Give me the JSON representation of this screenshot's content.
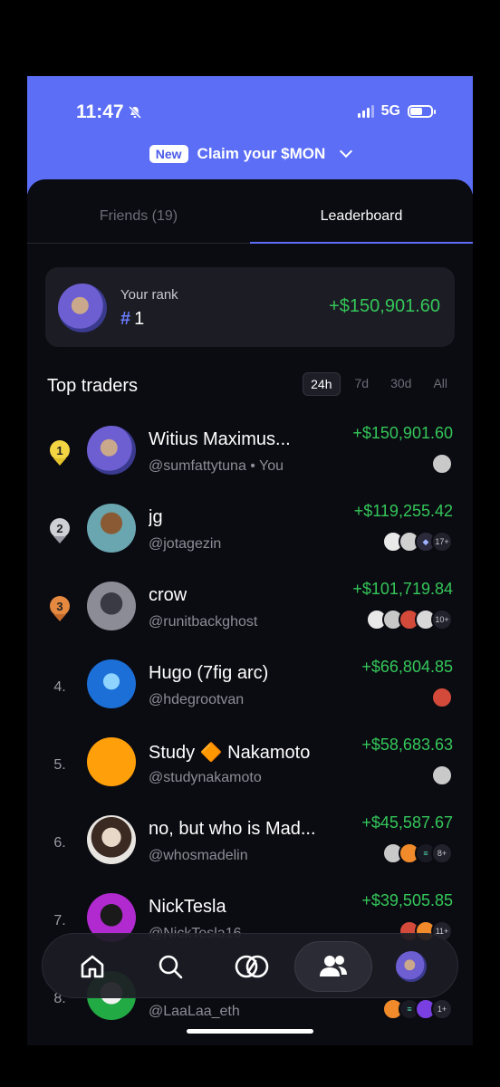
{
  "status_bar": {
    "time": "11:47",
    "network": "5G"
  },
  "banner": {
    "badge": "New",
    "text": "Claim your $MON"
  },
  "tabs": [
    {
      "label": "Friends (19)"
    },
    {
      "label": "Leaderboard"
    }
  ],
  "your_rank": {
    "label": "Your rank",
    "hash": "#",
    "rank": "1",
    "value": "+$150,901.60"
  },
  "top_traders": {
    "title": "Top traders",
    "filters": [
      "24h",
      "7d",
      "30d",
      "All"
    ],
    "rows": [
      {
        "position": "1",
        "name": "Witius Maximus...",
        "handle": "@sumfattytuna • You",
        "pnl": "+$150,901.60",
        "more": ""
      },
      {
        "position": "2",
        "name": "jg",
        "handle": "@jotagezin",
        "pnl": "+$119,255.42",
        "more": "17+"
      },
      {
        "position": "3",
        "name": "crow",
        "handle": "@runitbackghost",
        "pnl": "+$101,719.84",
        "more": "10+"
      },
      {
        "position": "4.",
        "name": "Hugo (7fig arc)",
        "handle": "@hdegrootvan",
        "pnl": "+$66,804.85",
        "more": ""
      },
      {
        "position": "5.",
        "name": "Study 🔶 Nakamoto",
        "handle": "@studynakamoto",
        "pnl": "+$58,683.63",
        "more": ""
      },
      {
        "position": "6.",
        "name": "no, but who is Mad...",
        "handle": "@whosmadelin",
        "pnl": "+$45,587.67",
        "more": "8+"
      },
      {
        "position": "7.",
        "name": "NickTesla",
        "handle": "@NickTesla16",
        "pnl": "+$39,505.85",
        "more": "11+"
      },
      {
        "position": "8.",
        "name": "",
        "handle": "@LaaLaa_eth",
        "pnl": "",
        "more": "1+"
      }
    ]
  },
  "nav": [
    "home-icon",
    "search-icon",
    "swap-icon",
    "friends-icon",
    "profile-avatar"
  ]
}
